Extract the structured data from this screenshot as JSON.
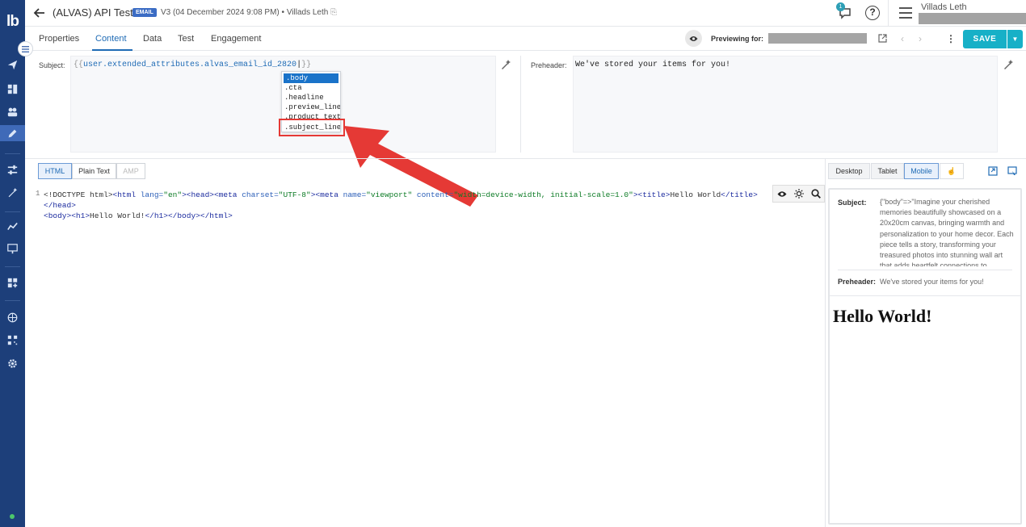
{
  "app": {
    "logo": "lb"
  },
  "header": {
    "title": "(ALVAS) API Test",
    "badge": "EMAIL",
    "version": "V3 (04 December 2024 9:08 PM)",
    "author": "Villads Leth",
    "notifications": "1",
    "help": "?",
    "user_name": "Villads Leth"
  },
  "tabs": [
    "Properties",
    "Content",
    "Data",
    "Test",
    "Engagement"
  ],
  "active_tab": "Content",
  "preview": {
    "label": "Previewing for:"
  },
  "save": {
    "label": "SAVE"
  },
  "subject": {
    "label": "Subject:",
    "open": "{{",
    "value": "user.extended_attributes.alvas_email_id_2820",
    "close": "}}"
  },
  "autocomplete": [
    ".body",
    ".cta",
    ".headline",
    ".preview_line",
    ".product_text",
    ".subject_line"
  ],
  "autocomplete_selected": ".body",
  "autocomplete_highlighted": ".subject_line",
  "preheader": {
    "label": "Preheader:",
    "value": "We've stored your items for you!"
  },
  "editor": {
    "modes": [
      "HTML",
      "Plain Text",
      "AMP"
    ],
    "active_mode": "HTML",
    "line_number": "1",
    "code": {
      "doctype": "<!DOCTYPE html>",
      "html_open": "<html ",
      "lang_attr": "lang=",
      "lang_val": "\"en\"",
      "head_open": "><head><meta ",
      "charset_attr": "charset=",
      "charset_val": "\"UTF-8\"",
      "meta2_open": "><meta ",
      "name_attr": "name=",
      "name_val": "\"viewport\"",
      "content_attr": " content=",
      "content_val": "\"width=device-width, initial-scale=1.0\"",
      "title_open": "><title>",
      "title_text": "Hello World",
      "title_close": "</title></head>",
      "body_open": "<body>",
      "h1_open": "<h1>",
      "h1_text": "Hello World!",
      "h1_close": "</h1></body></html>"
    }
  },
  "devices": [
    "Desktop",
    "Tablet",
    "Mobile"
  ],
  "active_device": "Mobile",
  "preview_panel": {
    "subject_label": "Subject:",
    "subject_text": "{\"body\"=>\"Imagine your cherished memories beautifully showcased on a 20x20cm canvas, bringing warmth and personalization to your home decor. Each piece tells a story, transforming your treasured photos into stunning wall art that adds heartfelt connections to",
    "preheader_label": "Preheader:",
    "preheader_text": "We've stored your items for you!",
    "heading": "Hello World!"
  },
  "colors": {
    "rail": "#1d3f7a",
    "accent": "#1f6bb5",
    "save": "#17b0c7",
    "annotation": "#e53935"
  }
}
